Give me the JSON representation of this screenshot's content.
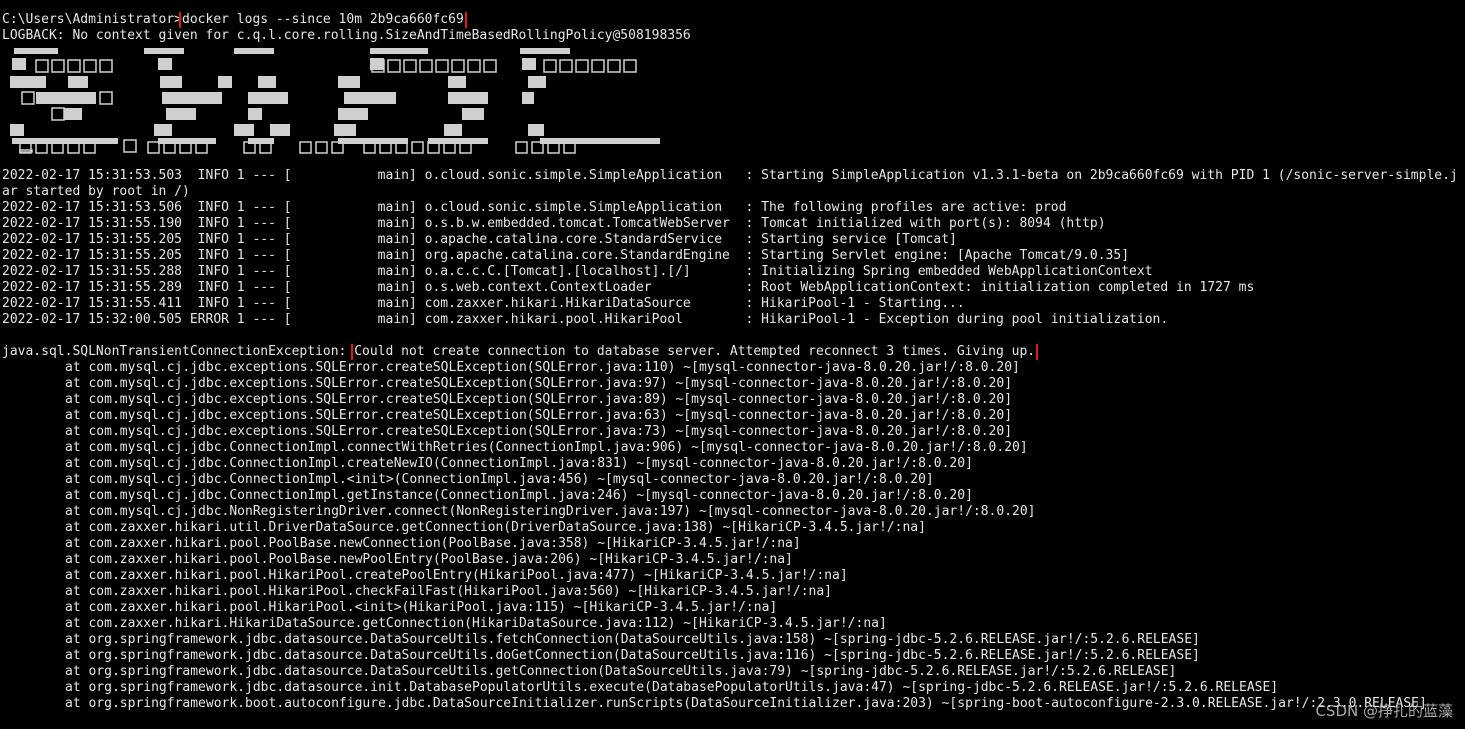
{
  "prompt": "C:\\Users\\Administrator>",
  "command": "docker logs --since 10m 2b9ca660fc69",
  "logback_warning": "LOGBACK: No context given for c.q.l.core.rolling.SizeAndTimeBasedRollingPolicy@508198356",
  "startup_lines": [
    {
      "text": "2022-02-17 15:31:53.503  INFO 1 --- [           main] o.cloud.sonic.simple.SimpleApplication   : Starting SimpleApplication v1.3.1-beta on 2b9ca660fc69 with PID 1 (/sonic-server-simple.jar started by root in /)",
      "wrap": true
    },
    {
      "text": "2022-02-17 15:31:53.506  INFO 1 --- [           main] o.cloud.sonic.simple.SimpleApplication   : The following profiles are active: prod"
    },
    {
      "text": "2022-02-17 15:31:55.190  INFO 1 --- [           main] o.s.b.w.embedded.tomcat.TomcatWebServer  : Tomcat initialized with port(s): 8094 (http)"
    },
    {
      "text": "2022-02-17 15:31:55.205  INFO 1 --- [           main] o.apache.catalina.core.StandardService   : Starting service [Tomcat]"
    },
    {
      "text": "2022-02-17 15:31:55.205  INFO 1 --- [           main] org.apache.catalina.core.StandardEngine  : Starting Servlet engine: [Apache Tomcat/9.0.35]"
    },
    {
      "text": "2022-02-17 15:31:55.288  INFO 1 --- [           main] o.a.c.c.C.[Tomcat].[localhost].[/]       : Initializing Spring embedded WebApplicationContext"
    },
    {
      "text": "2022-02-17 15:31:55.289  INFO 1 --- [           main] o.s.web.context.ContextLoader            : Root WebApplicationContext: initialization completed in 1727 ms"
    },
    {
      "text": "2022-02-17 15:31:55.411  INFO 1 --- [           main] com.zaxxer.hikari.HikariDataSource       : HikariPool-1 - Starting..."
    },
    {
      "text": "2022-02-17 15:32:00.505 ERROR 1 --- [           main] com.zaxxer.hikari.pool.HikariPool        : HikariPool-1 - Exception during pool initialization."
    }
  ],
  "exception": {
    "class": "java.sql.SQLNonTransientConnectionException: ",
    "message": "Could not create connection to database server. Attempted reconnect 3 times. Giving up."
  },
  "stack_trace": [
    "at com.mysql.cj.jdbc.exceptions.SQLError.createSQLException(SQLError.java:110) ~[mysql-connector-java-8.0.20.jar!/:8.0.20]",
    "at com.mysql.cj.jdbc.exceptions.SQLError.createSQLException(SQLError.java:97) ~[mysql-connector-java-8.0.20.jar!/:8.0.20]",
    "at com.mysql.cj.jdbc.exceptions.SQLError.createSQLException(SQLError.java:89) ~[mysql-connector-java-8.0.20.jar!/:8.0.20]",
    "at com.mysql.cj.jdbc.exceptions.SQLError.createSQLException(SQLError.java:63) ~[mysql-connector-java-8.0.20.jar!/:8.0.20]",
    "at com.mysql.cj.jdbc.exceptions.SQLError.createSQLException(SQLError.java:73) ~[mysql-connector-java-8.0.20.jar!/:8.0.20]",
    "at com.mysql.cj.jdbc.ConnectionImpl.connectWithRetries(ConnectionImpl.java:906) ~[mysql-connector-java-8.0.20.jar!/:8.0.20]",
    "at com.mysql.cj.jdbc.ConnectionImpl.createNewIO(ConnectionImpl.java:831) ~[mysql-connector-java-8.0.20.jar!/:8.0.20]",
    "at com.mysql.cj.jdbc.ConnectionImpl.<init>(ConnectionImpl.java:456) ~[mysql-connector-java-8.0.20.jar!/:8.0.20]",
    "at com.mysql.cj.jdbc.ConnectionImpl.getInstance(ConnectionImpl.java:246) ~[mysql-connector-java-8.0.20.jar!/:8.0.20]",
    "at com.mysql.cj.jdbc.NonRegisteringDriver.connect(NonRegisteringDriver.java:197) ~[mysql-connector-java-8.0.20.jar!/:8.0.20]",
    "at com.zaxxer.hikari.util.DriverDataSource.getConnection(DriverDataSource.java:138) ~[HikariCP-3.4.5.jar!/:na]",
    "at com.zaxxer.hikari.pool.PoolBase.newConnection(PoolBase.java:358) ~[HikariCP-3.4.5.jar!/:na]",
    "at com.zaxxer.hikari.pool.PoolBase.newPoolEntry(PoolBase.java:206) ~[HikariCP-3.4.5.jar!/:na]",
    "at com.zaxxer.hikari.pool.HikariPool.createPoolEntry(HikariPool.java:477) ~[HikariCP-3.4.5.jar!/:na]",
    "at com.zaxxer.hikari.pool.HikariPool.checkFailFast(HikariPool.java:560) ~[HikariCP-3.4.5.jar!/:na]",
    "at com.zaxxer.hikari.pool.HikariPool.<init>(HikariPool.java:115) ~[HikariCP-3.4.5.jar!/:na]",
    "at com.zaxxer.hikari.HikariDataSource.getConnection(HikariDataSource.java:112) ~[HikariCP-3.4.5.jar!/:na]",
    "at org.springframework.jdbc.datasource.DataSourceUtils.fetchConnection(DataSourceUtils.java:158) ~[spring-jdbc-5.2.6.RELEASE.jar!/:5.2.6.RELEASE]",
    "at org.springframework.jdbc.datasource.DataSourceUtils.doGetConnection(DataSourceUtils.java:116) ~[spring-jdbc-5.2.6.RELEASE.jar!/:5.2.6.RELEASE]",
    "at org.springframework.jdbc.datasource.DataSourceUtils.getConnection(DataSourceUtils.java:79) ~[spring-jdbc-5.2.6.RELEASE.jar!/:5.2.6.RELEASE]",
    "at org.springframework.jdbc.datasource.init.DatabasePopulatorUtils.execute(DatabasePopulatorUtils.java:47) ~[spring-jdbc-5.2.6.RELEASE.jar!/:5.2.6.RELEASE]",
    "at org.springframework.boot.autoconfigure.jdbc.DataSourceInitializer.runScripts(DataSourceInitializer.java:203) ~[spring-boot-autoconfigure-2.3.0.RELEASE.jar!/:2.3.0.RELEASE]"
  ],
  "watermark": "CSDN @挣扎的蓝藻",
  "colors": {
    "background": "#000000",
    "text": "#e6e6e6",
    "highlight_box": "#e0191d"
  },
  "banner_icon": "ascii-art-logo"
}
